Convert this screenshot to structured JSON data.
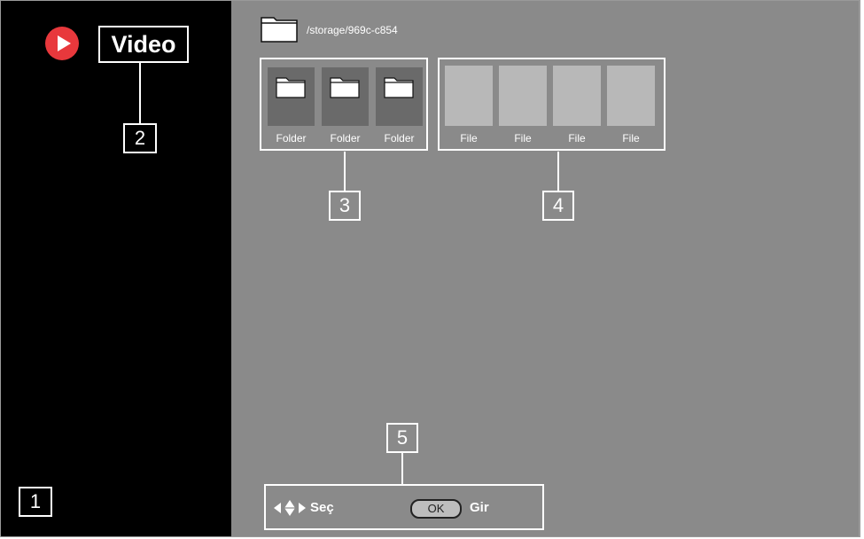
{
  "sidebar": {
    "title": "Video",
    "callout_title": "2",
    "callout_sidebar": "1"
  },
  "path": {
    "text": "/storage/969c-c854"
  },
  "folders": {
    "labels": [
      "Folder",
      "Folder",
      "Folder"
    ],
    "callout": "3"
  },
  "files": {
    "labels": [
      "File",
      "File",
      "File",
      "File"
    ],
    "callout": "4"
  },
  "legend": {
    "select_label": "Seç",
    "ok_key": "OK",
    "enter_label": "Gir",
    "callout": "5"
  },
  "colors": {
    "sidebar_bg": "#000000",
    "main_bg": "#8a8a8a",
    "play_icon": "#e8383c",
    "folder_tile": "#6a6a6a",
    "file_tile": "#b8b8b8"
  },
  "icons": {
    "app": "play-icon",
    "path": "folder-icon",
    "folder_tile": "folder-icon",
    "navigation": "arrow-keys-icon"
  }
}
